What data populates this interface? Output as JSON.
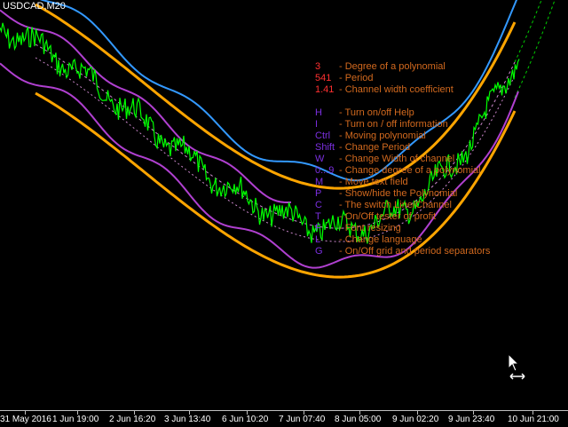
{
  "chart": {
    "symbol": "USDCAD,M20",
    "colors": {
      "background": "#000000",
      "price": "#00ff00",
      "channel": "#ffa500",
      "bands_purple": "#b040d0",
      "bands_blue": "#3399ff",
      "dashed_inner": "#cc88cc",
      "dashed_outer": "#00cc00",
      "parameter_keys": "#ff3030",
      "help_keys": "#7b2fe0",
      "descriptions": "#d2691e"
    }
  },
  "parameters": [
    {
      "key": "3",
      "desc": "- Degree of a polynomial"
    },
    {
      "key": "541",
      "desc": "- Period"
    },
    {
      "key": "1.41",
      "desc": "- Channel width coefficient"
    }
  ],
  "help": [
    {
      "key": "H",
      "desc": "- Turn on/off Help"
    },
    {
      "key": "I",
      "desc": "- Turn on / off information"
    },
    {
      "key": "Ctrl",
      "desc": "- Moving polynomial"
    },
    {
      "key": "Shift",
      "desc": "- Change Period"
    },
    {
      "key": "W",
      "desc": "- Change Width of channel"
    },
    {
      "key": "0...9",
      "desc": "- Change degree of a polynomial"
    },
    {
      "key": "M",
      "desc": "- Move text field"
    },
    {
      "key": "P",
      "desc": "- Show/hide the Polynomial"
    },
    {
      "key": "C",
      "desc": "- The switch Line/Channel"
    },
    {
      "key": "T",
      "desc": "- On/Off tester of profit"
    },
    {
      "key": "F",
      "desc": "- Font resizing"
    },
    {
      "key": "L",
      "desc": "- Change language"
    },
    {
      "key": "G",
      "desc": "- On/Off grid and period separators"
    }
  ],
  "time_axis": [
    "31 May 2016",
    "1 Jun 19:00",
    "2 Jun 16:20",
    "3 Jun 13:40",
    "6 Jun 10:20",
    "7 Jun 07:40",
    "8 Jun 05:00",
    "9 Jun 02:20",
    "9 Jun 23:40",
    "10 Jun 21:00"
  ]
}
